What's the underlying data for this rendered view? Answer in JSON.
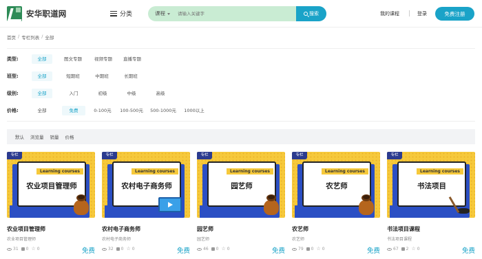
{
  "header": {
    "logo_text": "安华职道网",
    "category_label": "分类",
    "search_type": "课程",
    "search_placeholder": "请输入关键字",
    "search_button": "搜索",
    "my_courses": "我的课程",
    "login": "登录",
    "register": "免费注册"
  },
  "breadcrumb": [
    "首页",
    "专栏列表",
    "全部"
  ],
  "filters": [
    {
      "label": "类型:",
      "options": [
        "全部",
        "图文专题",
        "视频专题",
        "直播专题"
      ],
      "active": 0
    },
    {
      "label": "班型:",
      "options": [
        "全部",
        "短期班",
        "中期班",
        "长期班"
      ],
      "active": 0
    },
    {
      "label": "级别:",
      "options": [
        "全部",
        "入门",
        "初级",
        "中级",
        "高级"
      ],
      "active": 0
    },
    {
      "label": "价格:",
      "options": [
        "全部",
        "免费",
        "0-100元",
        "100-500元",
        "500-1000元",
        "1000以上"
      ],
      "active": 1
    }
  ],
  "sort": [
    "默认",
    "浏览量",
    "销量",
    "价格"
  ],
  "cards": [
    {
      "tag": "专栏",
      "banner": "Learning courses",
      "thumb_title": "农业项目管理师",
      "title": "农业项目管理师",
      "subtitle": "农业项目管理师",
      "views": "31",
      "users": "0",
      "stars": "0",
      "price": "免费",
      "illustration": "sack-icon"
    },
    {
      "tag": "专栏",
      "banner": "Learning courses",
      "thumb_title": "农村电子商务师",
      "title": "农村电子商务师",
      "subtitle": "农村电子商务师",
      "views": "32",
      "users": "0",
      "stars": "0",
      "price": "免费",
      "illustration": "monitor-icon"
    },
    {
      "tag": "专栏",
      "banner": "Learning courses",
      "thumb_title": "园艺师",
      "title": "园艺师",
      "subtitle": "园艺师",
      "views": "46",
      "users": "0",
      "stars": "0",
      "price": "免费",
      "illustration": "sack-icon"
    },
    {
      "tag": "专栏",
      "banner": "Learning courses",
      "thumb_title": "农艺师",
      "title": "农艺师",
      "subtitle": "农艺师",
      "views": "79",
      "users": "0",
      "stars": "0",
      "price": "免费",
      "illustration": "sack-icon"
    },
    {
      "tag": "专栏",
      "banner": "Learning courses",
      "thumb_title": "书法项目",
      "title": "书法项目课程",
      "subtitle": "书法项目课程",
      "views": "67",
      "users": "2",
      "stars": "0",
      "price": "免费",
      "illustration": "brush-icon"
    }
  ],
  "colors": {
    "accent": "#1aa3c8",
    "search_bg": "#c9ecd3",
    "thumb_yellow": "#f6c93b",
    "thumb_blue": "#2b4fc4"
  }
}
